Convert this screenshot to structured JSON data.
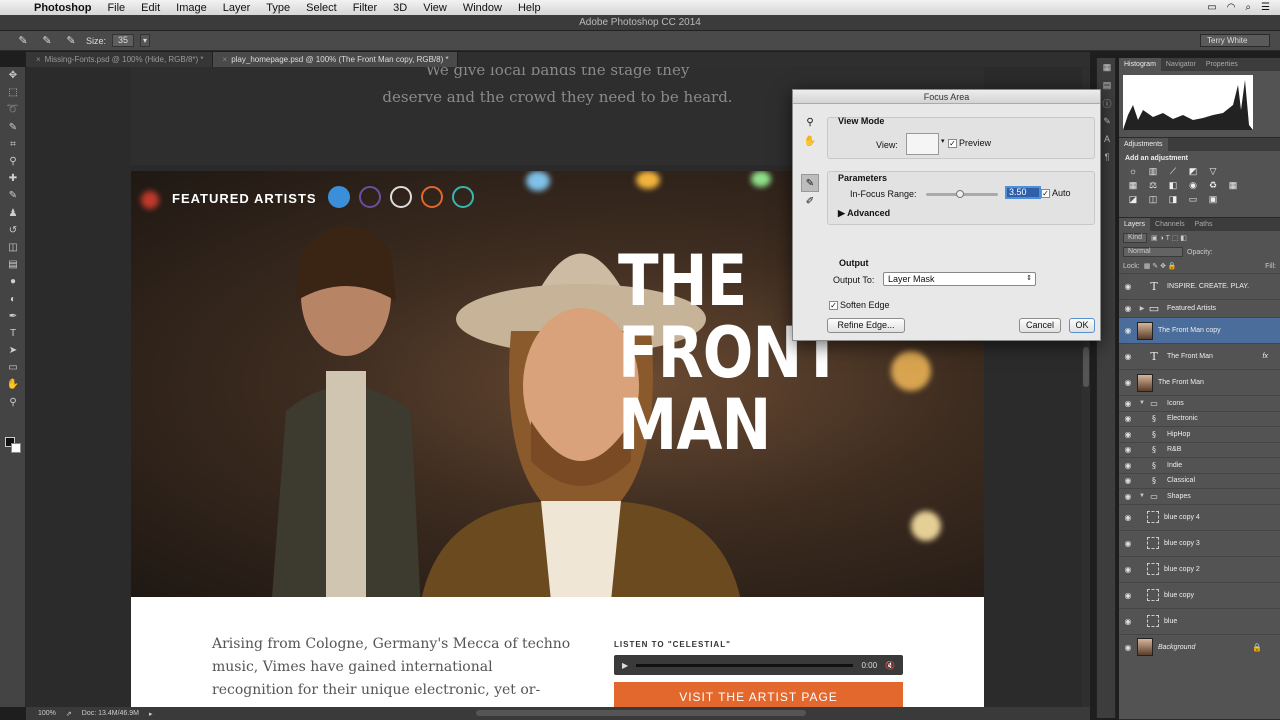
{
  "menubar": {
    "app_name": "Photoshop",
    "items": [
      "File",
      "Edit",
      "Image",
      "Layer",
      "Type",
      "Select",
      "Filter",
      "3D",
      "View",
      "Window",
      "Help"
    ]
  },
  "window_title": "Adobe Photoshop CC 2014",
  "options_bar": {
    "size_label": "Size:",
    "size_value": "35",
    "workspace": "Terry White"
  },
  "tabs": [
    {
      "label": "Missing-Fonts.psd @ 100% (Hide, RGB/8*) *"
    },
    {
      "label": "play_homepage.psd @ 100% (The Front Man copy, RGB/8) *"
    }
  ],
  "canvas": {
    "tagline_1": "We give local bands the stage they",
    "tagline_2": "deserve and the crowd they need to be heard.",
    "featured": "FEATURED ARTISTS",
    "hero_title": [
      "THE",
      "FRONT",
      "MAN"
    ],
    "bio": "Arising from Cologne, Germany's Mecca of techno music, Vimes have gained international recognition for their unique electronic, yet or-",
    "listen_label": "LISTEN TO \"CELESTIAL\"",
    "player_time": "0:00",
    "visit_button": "VISIT THE ARTIST PAGE",
    "dot_colors": [
      "#3b8fd8",
      "#6a4fa0",
      "#dddddd",
      "#e0682e",
      "#3bb5b0"
    ]
  },
  "status": {
    "zoom": "100%",
    "doc": "Doc: 13.4M/46.9M"
  },
  "panels": {
    "top_tabs": [
      "Histogram",
      "Navigator",
      "Properties"
    ],
    "adj_tabs": [
      "Adjustments"
    ],
    "adj_title": "Add an adjustment",
    "layer_tabs": [
      "Layers",
      "Channels",
      "Paths"
    ],
    "kind": "Kind",
    "blend": "Normal",
    "opacity_label": "Opacity:",
    "lock_label": "Lock:",
    "fill_label": "Fill:"
  },
  "layers": [
    {
      "name": "INSPIRE. CREATE. PLAY.",
      "kind": "text"
    },
    {
      "name": "Featured Artists",
      "kind": "group"
    },
    {
      "name": "The Front Man copy",
      "kind": "image",
      "selected": true
    },
    {
      "name": "The Front Man",
      "kind": "text",
      "fx": "fx"
    },
    {
      "name": "The Front Man",
      "kind": "image"
    },
    {
      "name": "Icons",
      "kind": "group-open"
    },
    {
      "name": "Electronic",
      "kind": "smart"
    },
    {
      "name": "HipHop",
      "kind": "smart"
    },
    {
      "name": "R&B",
      "kind": "smart"
    },
    {
      "name": "Indie",
      "kind": "smart"
    },
    {
      "name": "Classical",
      "kind": "smart"
    },
    {
      "name": "Shapes",
      "kind": "group-open"
    },
    {
      "name": "blue copy 4",
      "kind": "shape"
    },
    {
      "name": "blue copy 3",
      "kind": "shape"
    },
    {
      "name": "blue copy 2",
      "kind": "shape"
    },
    {
      "name": "blue copy",
      "kind": "shape"
    },
    {
      "name": "blue",
      "kind": "shape"
    },
    {
      "name": "Background",
      "kind": "background"
    }
  ],
  "dialog": {
    "title": "Focus Area",
    "view_mode": "View Mode",
    "view_label": "View:",
    "preview": "Preview",
    "parameters": "Parameters",
    "in_focus_range": "In-Focus Range:",
    "range_value": "3.50",
    "auto": "Auto",
    "advanced": "Advanced",
    "output": "Output",
    "output_to": "Output To:",
    "output_value": "Layer Mask",
    "soften_edge": "Soften Edge",
    "refine_edge": "Refine Edge...",
    "cancel": "Cancel",
    "ok": "OK"
  }
}
